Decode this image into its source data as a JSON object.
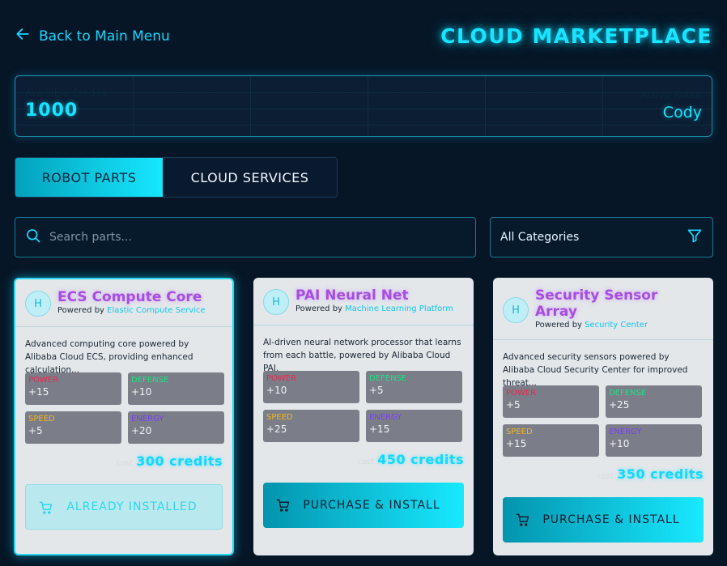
{
  "header": {
    "back_label": "Back to Main Menu",
    "title": "CLOUD MARKETPLACE"
  },
  "credits": {
    "available_label": "Available Credits",
    "available_value": "1000",
    "robot_label": "Active Robot",
    "robot_value": "Cody"
  },
  "tabs": [
    {
      "label": "ROBOT PARTS",
      "active": true
    },
    {
      "label": "CLOUD SERVICES",
      "active": false
    }
  ],
  "search": {
    "placeholder": "Search parts..."
  },
  "filter": {
    "selected": "All Categories"
  },
  "cards": [
    {
      "badge": "H",
      "title": "ECS Compute Core",
      "powered_prefix": "Powered by",
      "service": "Elastic Compute Service",
      "description": "Advanced computing core powered by Alibaba Cloud ECS, providing enhanced calculation...",
      "stats": {
        "power_label": "POWER",
        "power_value": "+15",
        "defense_label": "DEFENSE",
        "defense_value": "+10",
        "speed_label": "SPEED",
        "speed_value": "+5",
        "energy_label": "ENERGY",
        "energy_value": "+20"
      },
      "price_ghost": "cost",
      "price": "300 credits",
      "button_label": "ALREADY INSTALLED"
    },
    {
      "badge": "H",
      "title": "PAI Neural Net",
      "powered_prefix": "Powered by",
      "service": "Machine Learning Platform",
      "description": "AI-driven neural network processor that learns from each battle, powered by Alibaba Cloud PAI.",
      "stats": {
        "power_label": "POWER",
        "power_value": "+10",
        "defense_label": "DEFENSE",
        "defense_value": "+5",
        "speed_label": "SPEED",
        "speed_value": "+25",
        "energy_label": "ENERGY",
        "energy_value": "+15"
      },
      "price_ghost": "cost",
      "price": "450 credits",
      "button_label": "PURCHASE & INSTALL"
    },
    {
      "badge": "H",
      "title": "Security Sensor Array",
      "powered_prefix": "Powered by",
      "service": "Security Center",
      "description": "Advanced security sensors powered by Alibaba Cloud Security Center for improved threat...",
      "stats": {
        "power_label": "POWER",
        "power_value": "+5",
        "defense_label": "DEFENSE",
        "defense_value": "+25",
        "speed_label": "SPEED",
        "speed_value": "+15",
        "energy_label": "ENERGY",
        "energy_value": "+10"
      },
      "price_ghost": "cost",
      "price": "350 credits",
      "button_label": "PURCHASE & INSTALL"
    }
  ]
}
